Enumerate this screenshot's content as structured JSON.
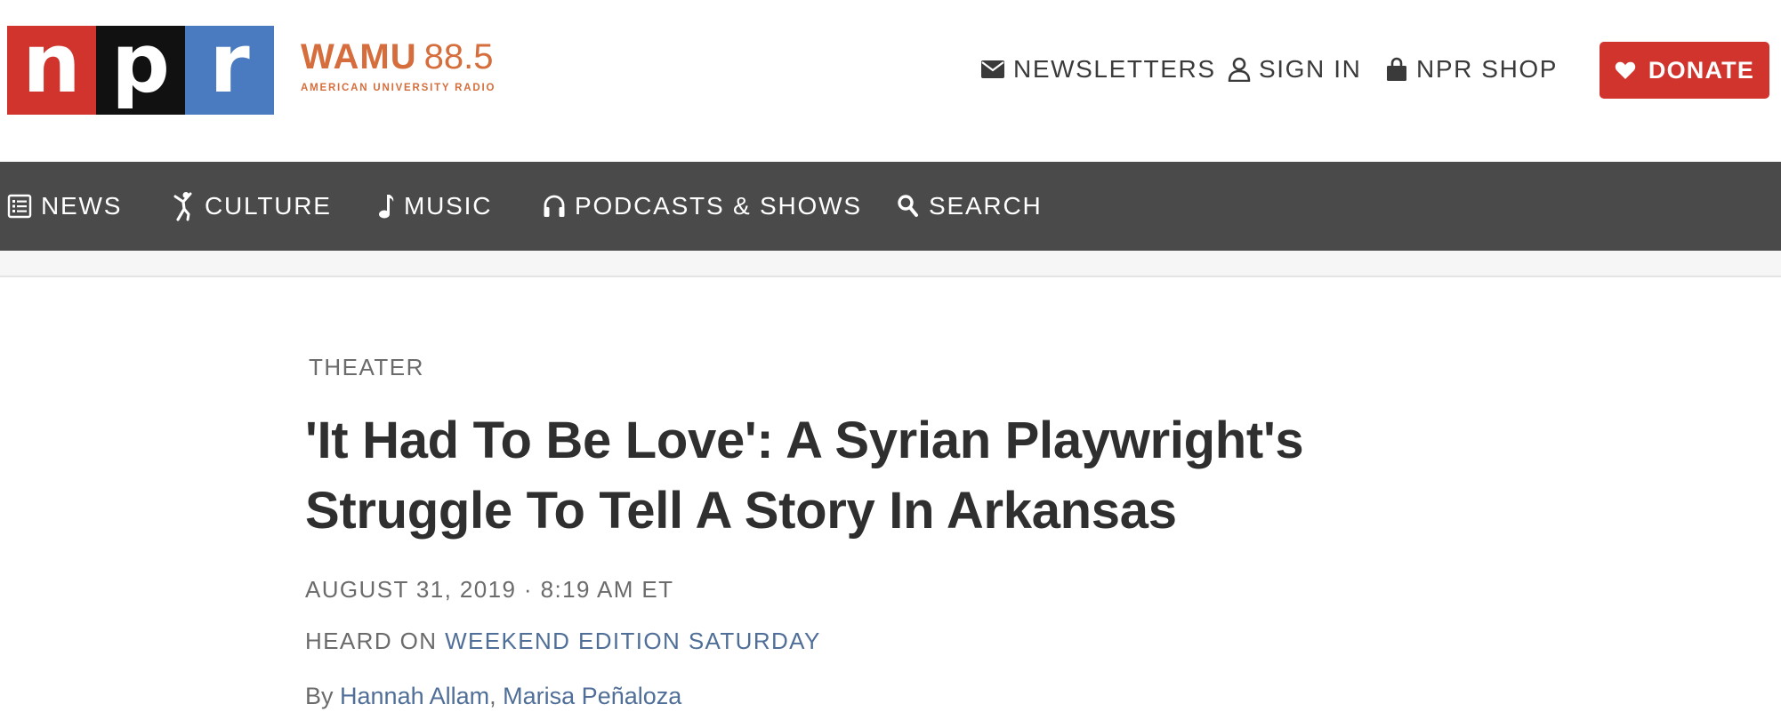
{
  "logo": {
    "letters": [
      "n",
      "p",
      "r"
    ]
  },
  "station": {
    "call": "WAMU",
    "freq": "88.5",
    "sub": "AMERICAN UNIVERSITY RADIO"
  },
  "utility": {
    "newsletters": "NEWSLETTERS",
    "sign_in": "SIGN IN",
    "shop": "NPR SHOP",
    "donate": "DONATE"
  },
  "nav": {
    "items": [
      {
        "label": "NEWS",
        "icon": "news-list-icon"
      },
      {
        "label": "CULTURE",
        "icon": "culture-figure-icon"
      },
      {
        "label": "MUSIC",
        "icon": "music-note-icon"
      },
      {
        "label": "PODCASTS & SHOWS",
        "icon": "headphones-icon"
      },
      {
        "label": "SEARCH",
        "icon": "search-icon"
      }
    ]
  },
  "article": {
    "slug": "THEATER",
    "headline_line1": "'It Had To Be Love': A Syrian Playwright's",
    "headline_line2": "Struggle To Tell A Story In Arkansas",
    "date": "AUGUST 31, 2019 · 8:19 AM ET",
    "heard_prefix": "HEARD ON",
    "heard_show": "WEEKEND EDITION SATURDAY",
    "by_prefix": "By",
    "authors": [
      "Hannah Allam",
      "Marisa Peñaloza"
    ],
    "author_sep": ","
  },
  "colors": {
    "npr_red": "#d0342c",
    "npr_black": "#111111",
    "npr_blue": "#4a7bc0",
    "wamu_orange": "#d56e3c",
    "nav_bg": "#4a4a4a",
    "link_blue": "#4f6e98"
  }
}
